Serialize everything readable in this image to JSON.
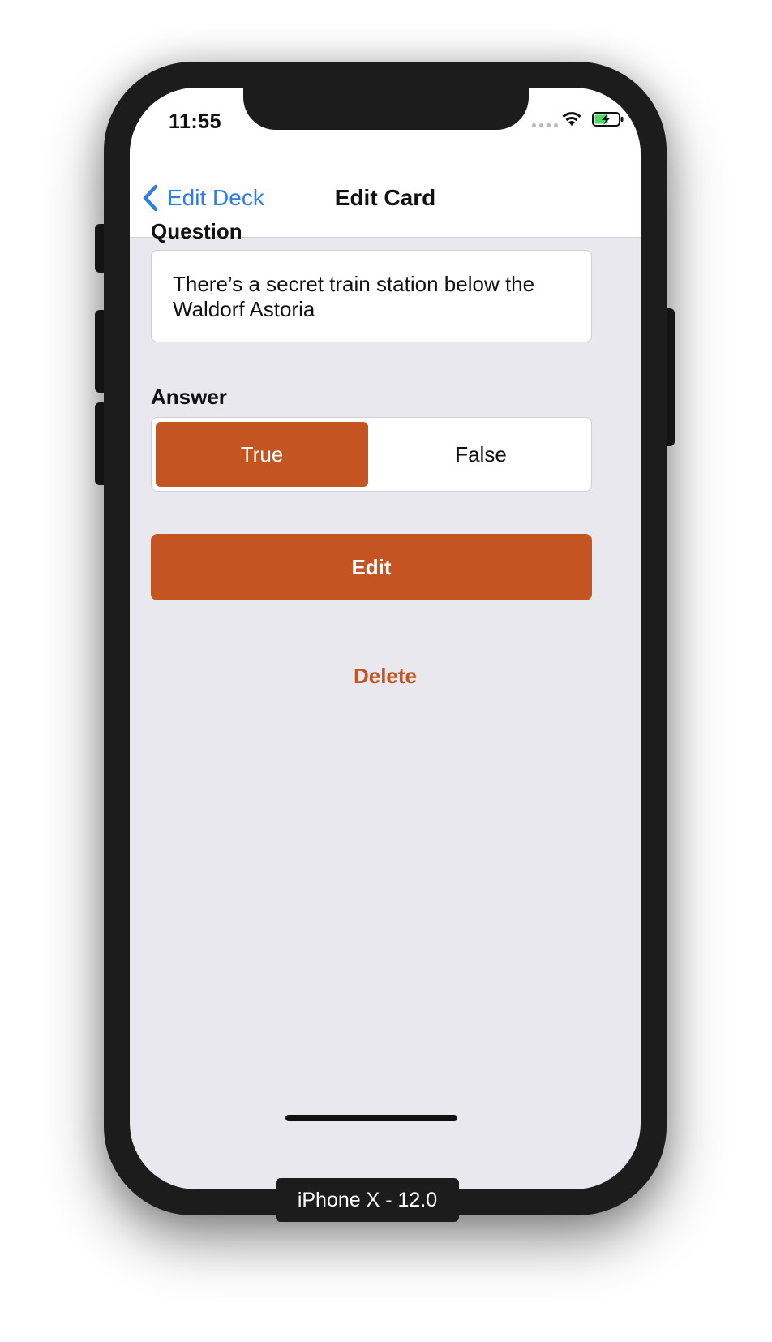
{
  "status_bar": {
    "time": "11:55"
  },
  "nav": {
    "back_label": "Edit Deck",
    "title": "Edit Card"
  },
  "question": {
    "label": "Question",
    "value": "There’s a secret train station below the Waldorf Astoria"
  },
  "answer": {
    "label": "Answer",
    "options": [
      "True",
      "False"
    ],
    "selected": "True"
  },
  "actions": {
    "edit_label": "Edit",
    "delete_label": "Delete"
  },
  "device": {
    "label": "iPhone X - 12.0"
  },
  "colors": {
    "accent": "#c45422",
    "link": "#2f7de0",
    "background": "#e9e8ee"
  },
  "icons": {
    "back": "chevron-left-icon",
    "wifi": "wifi-icon",
    "battery": "battery-charging-icon"
  }
}
